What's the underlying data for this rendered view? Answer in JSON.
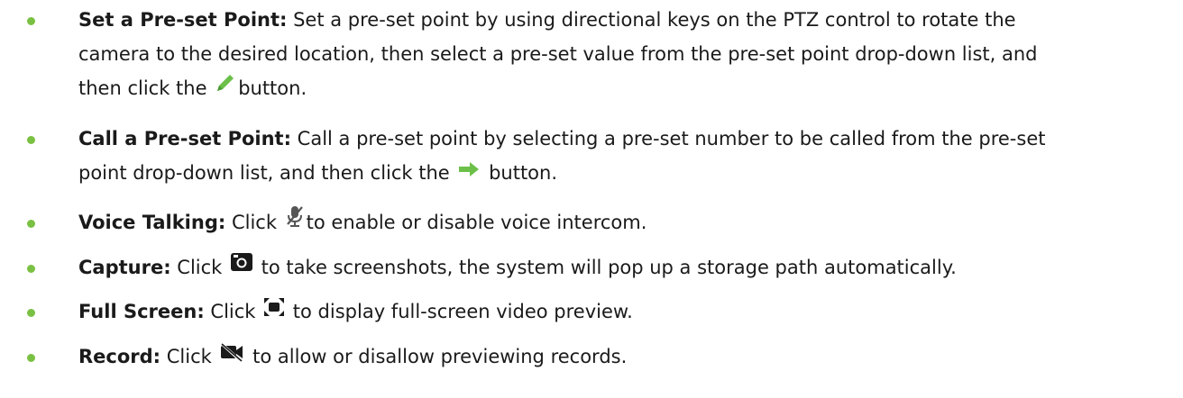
{
  "items": [
    {
      "term": "Set a Pre-set Point:",
      "line1": " Set a pre-set point by using directional keys on the PTZ control to rotate the",
      "line2": "camera to the desired location, then select a pre-set value from the pre-set point drop-down list, and",
      "line3_before": "then click the ",
      "line3_after": "button.",
      "icon": "pencil-icon"
    },
    {
      "term": "Call a Pre-set Point:",
      "line1": " Call a pre-set point by selecting a pre-set number to be called from the pre-set",
      "line2_before": "point drop-down list, and then click the ",
      "line2_after": " button.",
      "icon": "arrow-right-icon"
    },
    {
      "term": "Voice Talking:",
      "before": " Click ",
      "after": "to enable or disable voice intercom.",
      "icon": "microphone-muted-icon"
    },
    {
      "term": "Capture:",
      "before": " Click ",
      "after": " to take screenshots, the system will pop up a storage path automatically.",
      "icon": "camera-icon"
    },
    {
      "term": "Full Screen:",
      "before": " Click ",
      "after": " to display full-screen video preview.",
      "icon": "fullscreen-icon"
    },
    {
      "term": "Record:",
      "before": " Click ",
      "after": " to allow or disallow previewing records.",
      "icon": "video-off-icon"
    }
  ],
  "colors": {
    "bullet": "#7ac143",
    "pencil": "#6cc04a",
    "arrow": "#6cc04a",
    "text": "#1a1a1a"
  }
}
